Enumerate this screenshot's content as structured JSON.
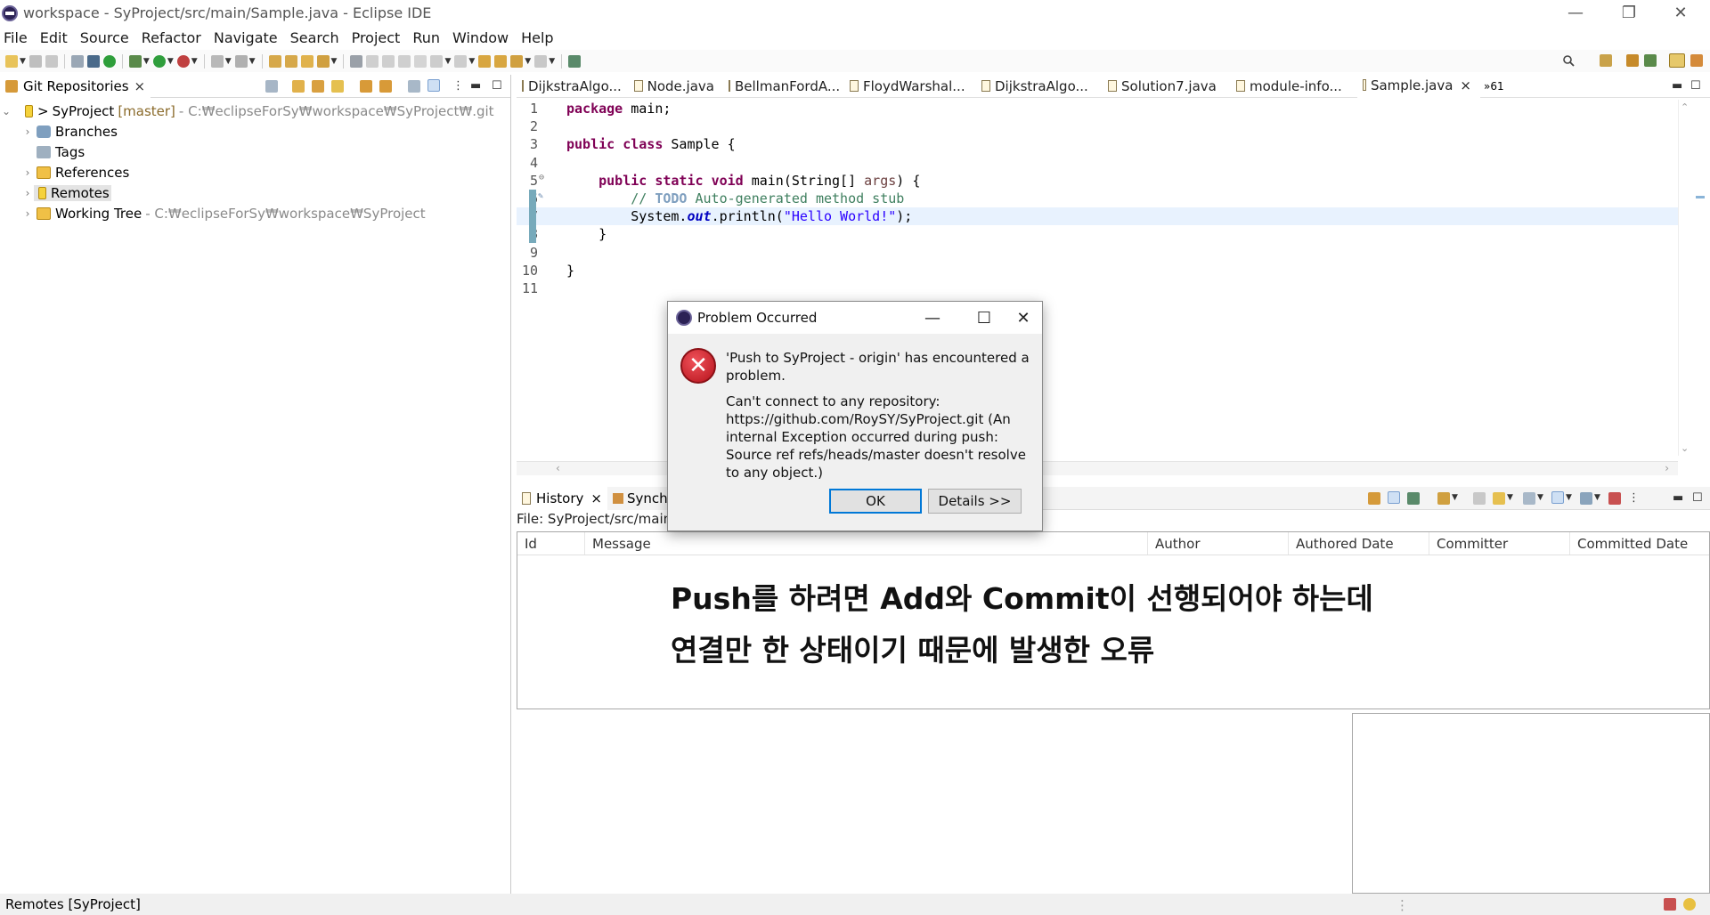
{
  "window": {
    "title": "workspace - SyProject/src/main/Sample.java - Eclipse IDE",
    "minimize": "—",
    "restore": "❐",
    "close": "✕"
  },
  "menu": [
    "File",
    "Edit",
    "Source",
    "Refactor",
    "Navigate",
    "Search",
    "Project",
    "Run",
    "Window",
    "Help"
  ],
  "git_view": {
    "tab_label": "Git Repositories",
    "tab_close": "×",
    "repo": {
      "name": "SyProject",
      "branch": "[master]",
      "path": "- C:₩eclipseForSy₩workspace₩SyProject₩.git"
    },
    "items": [
      {
        "label": "Branches"
      },
      {
        "label": "Tags"
      },
      {
        "label": "References"
      },
      {
        "label": "Remotes"
      },
      {
        "label": "Working Tree",
        "path": "- C:₩eclipseForSy₩workspace₩SyProject"
      }
    ]
  },
  "editor": {
    "tabs": [
      "DijkstraAlgo...",
      "Node.java",
      "BellmanFordA...",
      "FloydWarshal...",
      "DijkstraAlgo...",
      "Solution7.java",
      "module-info...",
      "Sample.java"
    ],
    "active_tab": "Sample.java",
    "overflow": "»61",
    "lines": [
      {
        "n": "1",
        "segs": [
          {
            "t": "package",
            "c": "kw"
          },
          {
            "t": " main;",
            "c": ""
          }
        ]
      },
      {
        "n": "2",
        "segs": []
      },
      {
        "n": "3",
        "segs": [
          {
            "t": "public",
            "c": "kw"
          },
          {
            "t": " ",
            "c": ""
          },
          {
            "t": "class",
            "c": "kw"
          },
          {
            "t": " Sample {",
            "c": ""
          }
        ]
      },
      {
        "n": "4",
        "segs": []
      },
      {
        "n": "5",
        "segs": [
          {
            "t": "    ",
            "c": ""
          },
          {
            "t": "public",
            "c": "kw"
          },
          {
            "t": " ",
            "c": ""
          },
          {
            "t": "static",
            "c": "kw"
          },
          {
            "t": " ",
            "c": ""
          },
          {
            "t": "void",
            "c": "kw"
          },
          {
            "t": " main(String[] ",
            "c": ""
          },
          {
            "t": "args",
            "c": "dimvar"
          },
          {
            "t": ") {",
            "c": ""
          }
        ]
      },
      {
        "n": "6",
        "segs": [
          {
            "t": "        // ",
            "c": "cm"
          },
          {
            "t": "TODO",
            "c": "todo"
          },
          {
            "t": " Auto-generated method stub",
            "c": "cm"
          }
        ]
      },
      {
        "n": "7",
        "segs": [
          {
            "t": "        System.",
            "c": ""
          },
          {
            "t": "out",
            "c": "fld"
          },
          {
            "t": ".println(",
            "c": ""
          },
          {
            "t": "\"Hello World!\"",
            "c": "str"
          },
          {
            "t": ");",
            "c": ""
          }
        ]
      },
      {
        "n": "8",
        "segs": [
          {
            "t": "    }",
            "c": ""
          }
        ]
      },
      {
        "n": "9",
        "segs": []
      },
      {
        "n": "10",
        "segs": [
          {
            "t": "}",
            "c": ""
          }
        ]
      },
      {
        "n": "11",
        "segs": []
      }
    ]
  },
  "history": {
    "tab_label": "History",
    "tab_close": "×",
    "sync_tab": "Synchro",
    "file_line": "File: SyProject/src/main/S",
    "columns": [
      "Id",
      "Message",
      "Author",
      "Authored Date",
      "Committer",
      "Committed Date"
    ],
    "annotation_line1": "Push를 하려면 Add와 Commit이 선행되어야 하는데",
    "annotation_line2": "연결만 한 상태이기 때문에 발생한 오류"
  },
  "dialog": {
    "title": "Problem Occurred",
    "message1": "'Push to SyProject - origin' has encountered a problem.",
    "message2": "Can't connect to any repository: https://github.com/RoySY/SyProject.git (An internal Exception occurred during push: Source ref refs/heads/master doesn't resolve to any object.)",
    "ok_label": "OK",
    "details_label": "Details >>",
    "minimize": "—",
    "maximize": "☐",
    "close": "✕",
    "error_glyph": "✕"
  },
  "status": {
    "text": "Remotes [SyProject]"
  }
}
